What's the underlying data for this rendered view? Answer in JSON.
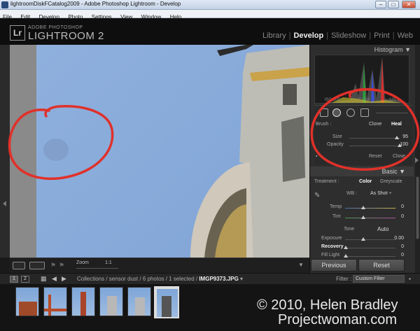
{
  "window": {
    "title": "lightroomDiskFCatalog2009 - Adobe Photoshop Lightroom - Develop",
    "minimize": "–",
    "maximize": "□",
    "close": "✕"
  },
  "menu": [
    "File",
    "Edit",
    "Develop",
    "Photo",
    "Settings",
    "View",
    "Window",
    "Help"
  ],
  "brand": {
    "logo": "Lr",
    "top": "ADOBE PHOTOSHOP",
    "name": "LIGHTROOM 2"
  },
  "modules": {
    "library": "Library",
    "develop": "Develop",
    "slideshow": "Slideshow",
    "print": "Print",
    "web": "Web",
    "separator": "|"
  },
  "right_panel": {
    "histogram_title": "Histogram ▼",
    "histogram_labels": [
      "ISO 100",
      "f / 5.6",
      "125 s"
    ],
    "brush": {
      "label": "Brush :",
      "clone": "Clone",
      "heal": "Heal"
    },
    "size": {
      "label": "Size",
      "value": "95",
      "fraction": 0.95
    },
    "opacity": {
      "label": "Opacity",
      "value": "100",
      "fraction": 1.0
    },
    "reset": "Reset",
    "close": "Close",
    "basic_title": "Basic ▼",
    "treatment": {
      "label": "Treatment :",
      "color": "Color",
      "grey": "Greyscale"
    },
    "wb": {
      "label": "WB :",
      "value": "As Shot ÷"
    },
    "temp": {
      "label": "Temp",
      "value": "0"
    },
    "tint": {
      "label": "Tint",
      "value": "0"
    },
    "tone": {
      "label": "Tone",
      "auto": "Auto"
    },
    "exposure": {
      "label": "Exposure",
      "value": "0.00"
    },
    "recovery": {
      "label": "Recovery",
      "value": "0"
    },
    "fill_light": {
      "label": "Fill Light",
      "value": "0"
    }
  },
  "toolbar": {
    "zoom_label": "Zoom",
    "zoom_value": "1:1"
  },
  "buttons": {
    "previous": "Previous",
    "reset": "Reset"
  },
  "filmbar": {
    "page1": "1",
    "page2": "2",
    "path_prefix": "Collections / sensor dust / 6 photos / 1 selected /",
    "filename": "IMGP9373.JPG",
    "filter_label": "Filter :",
    "filter_value": "Custom Filter"
  },
  "watermark": {
    "line1": "© 2010, Helen Bradley",
    "line2": "Projectwoman.com"
  },
  "colors": {
    "annotation_red": "#e0312a",
    "sky": "#88abdb",
    "panel": "#2e2e2e"
  }
}
